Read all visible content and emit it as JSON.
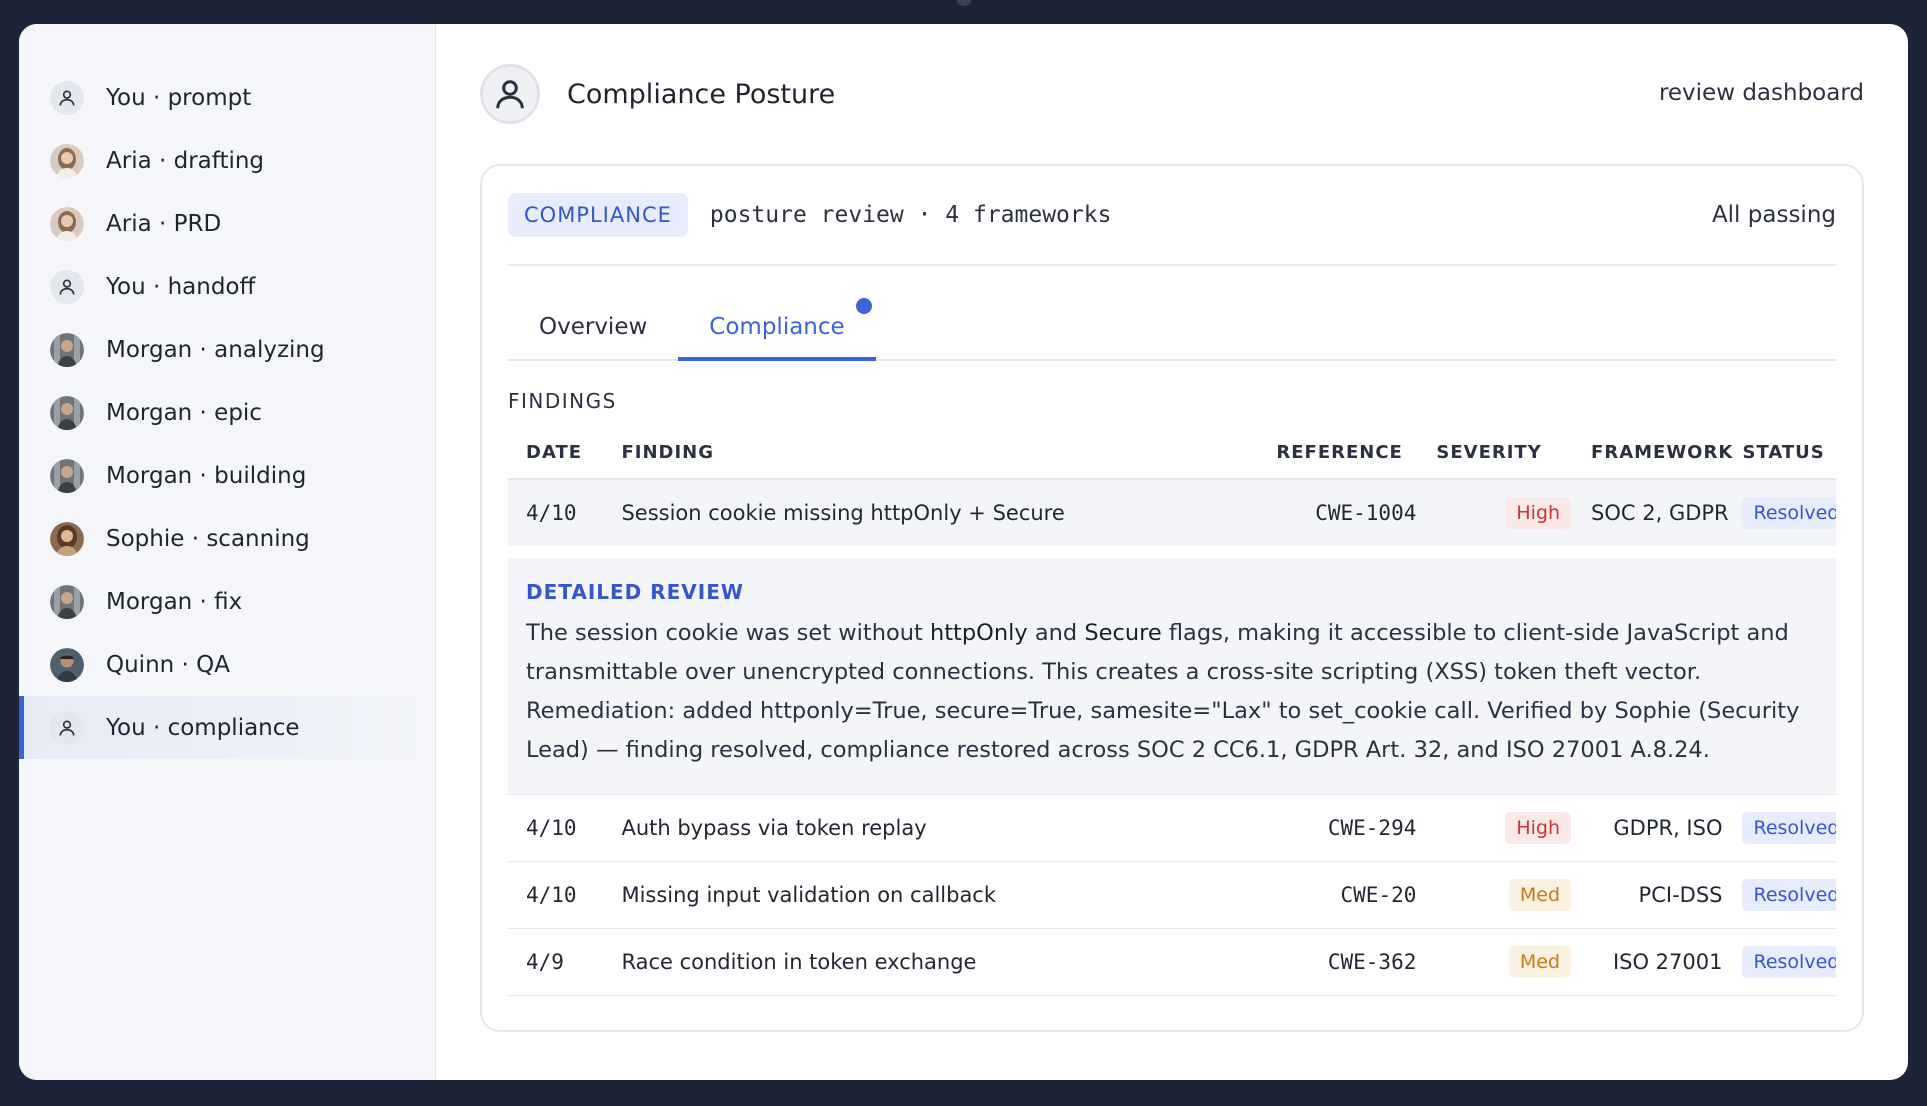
{
  "sidebar": {
    "items": [
      {
        "label": "You · prompt",
        "avatar": "user-icon"
      },
      {
        "label": "Aria · drafting",
        "avatar": "aria-photo"
      },
      {
        "label": "Aria · PRD",
        "avatar": "aria-photo"
      },
      {
        "label": "You · handoff",
        "avatar": "user-icon"
      },
      {
        "label": "Morgan · analyzing",
        "avatar": "morgan-photo"
      },
      {
        "label": "Morgan · epic",
        "avatar": "morgan-photo"
      },
      {
        "label": "Morgan · building",
        "avatar": "morgan-photo"
      },
      {
        "label": "Sophie · scanning",
        "avatar": "sophie-photo"
      },
      {
        "label": "Morgan · fix",
        "avatar": "morgan-photo"
      },
      {
        "label": "Quinn · QA",
        "avatar": "quinn-photo"
      },
      {
        "label": "You · compliance",
        "avatar": "user-icon",
        "active": true
      }
    ]
  },
  "header": {
    "title": "Compliance Posture",
    "right_label": "review dashboard"
  },
  "card": {
    "chip": "COMPLIANCE",
    "subtitle": "posture review · 4 frameworks",
    "status": "All passing"
  },
  "tabs": [
    {
      "label": "Overview",
      "active": false
    },
    {
      "label": "Compliance",
      "active": true,
      "has_dot": true
    }
  ],
  "findings": {
    "section_label": "FINDINGS",
    "columns": {
      "date": "DATE",
      "finding": "FINDING",
      "reference": "REFERENCE",
      "severity": "SEVERITY",
      "framework": "FRAMEWORK",
      "status": "STATUS"
    },
    "rows": [
      {
        "date": "4/10",
        "finding": "Session cookie missing httpOnly + Secure",
        "reference": "CWE-1004",
        "severity": "High",
        "framework": "SOC 2, GDPR",
        "status": "Resolved"
      },
      {
        "date": "4/10",
        "finding": "Auth bypass via token replay",
        "reference": "CWE-294",
        "severity": "High",
        "framework": "GDPR, ISO",
        "status": "Resolved"
      },
      {
        "date": "4/10",
        "finding": "Missing input validation on callback",
        "reference": "CWE-20",
        "severity": "Med",
        "framework": "PCI-DSS",
        "status": "Resolved"
      },
      {
        "date": "4/9",
        "finding": "Race condition in token exchange",
        "reference": "CWE-362",
        "severity": "Med",
        "framework": "ISO 27001",
        "status": "Resolved"
      }
    ],
    "detail": {
      "title": "DETAILED REVIEW",
      "text_1": "The session cookie was set without ",
      "bold_1": "httpOnly",
      "text_2": " and ",
      "bold_2": "Secure",
      "text_3": " flags, making it accessible to client-side JavaScript and transmittable over unencrypted connections. This creates a cross-site scripting (XSS) token theft vector. Remediation: added httponly=True, secure=True, samesite=\"Lax\" to set_cookie call. Verified by Sophie (Security Lead) — finding resolved, compliance restored across SOC 2 CC6.1, GDPR Art. 32, and ISO 27001 A.8.24."
    }
  },
  "colors": {
    "accent": "#3a63d8",
    "high": "#c7362f",
    "med": "#c77912",
    "background": "#1c2438"
  }
}
